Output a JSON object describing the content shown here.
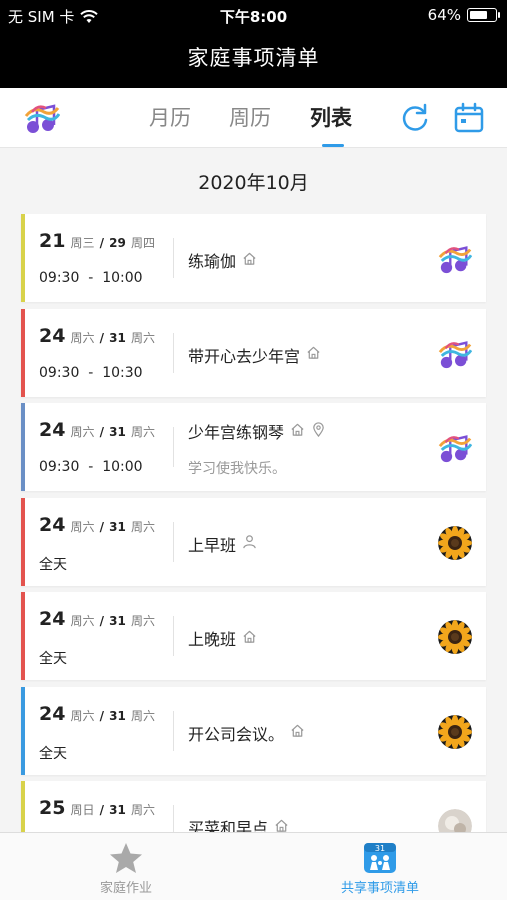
{
  "status": {
    "carrier": "无 SIM 卡",
    "time": "下午8:00",
    "battery": "64%",
    "battery_level": 0.64
  },
  "header": {
    "title": "家庭事项清单"
  },
  "tabs": [
    {
      "label": "月历"
    },
    {
      "label": "周历"
    },
    {
      "label": "列表"
    }
  ],
  "active_tab": "列表",
  "month_heading": "2020年10月",
  "events": [
    {
      "day": "21",
      "weekday": "周三",
      "sep": "/",
      "end_day": "29",
      "end_weekday": "周四",
      "time_start": "09:30",
      "time_dash": "-",
      "time_end": "10:00",
      "time_text": "",
      "title": "练瑜伽",
      "subtitle": "",
      "color": "#d8d24a",
      "icons": [
        "home-icon"
      ],
      "avatar": "app-logo"
    },
    {
      "day": "24",
      "weekday": "周六",
      "sep": "/",
      "end_day": "31",
      "end_weekday": "周六",
      "time_start": "09:30",
      "time_dash": "-",
      "time_end": "10:30",
      "time_text": "",
      "title": "带开心去少年宫",
      "subtitle": "",
      "color": "#e3534e",
      "icons": [
        "home-icon"
      ],
      "avatar": "app-logo"
    },
    {
      "day": "24",
      "weekday": "周六",
      "sep": "/",
      "end_day": "31",
      "end_weekday": "周六",
      "time_start": "09:30",
      "time_dash": "-",
      "time_end": "10:00",
      "time_text": "",
      "title": "少年宫练钢琴",
      "subtitle": "学习使我快乐。",
      "color": "#6a8fc5",
      "icons": [
        "home-icon",
        "location-icon"
      ],
      "avatar": "app-logo"
    },
    {
      "day": "24",
      "weekday": "周六",
      "sep": "/",
      "end_day": "31",
      "end_weekday": "周六",
      "time_start": "",
      "time_dash": "",
      "time_end": "",
      "time_text": "全天",
      "title": "上早班",
      "subtitle": "",
      "color": "#e3534e",
      "icons": [
        "person-icon"
      ],
      "avatar": "sunflower"
    },
    {
      "day": "24",
      "weekday": "周六",
      "sep": "/",
      "end_day": "31",
      "end_weekday": "周六",
      "time_start": "",
      "time_dash": "",
      "time_end": "",
      "time_text": "全天",
      "title": "上晚班",
      "subtitle": "",
      "color": "#e3534e",
      "icons": [
        "home-icon"
      ],
      "avatar": "sunflower"
    },
    {
      "day": "24",
      "weekday": "周六",
      "sep": "/",
      "end_day": "31",
      "end_weekday": "周六",
      "time_start": "",
      "time_dash": "",
      "time_end": "",
      "time_text": "全天",
      "title": "开公司会议。",
      "subtitle": "",
      "color": "#3a9ae0",
      "icons": [
        "home-icon"
      ],
      "avatar": "sunflower"
    },
    {
      "day": "25",
      "weekday": "周日",
      "sep": "/",
      "end_day": "31",
      "end_weekday": "周六",
      "time_start": "",
      "time_dash": "",
      "time_end": "",
      "time_text": "",
      "title": "买菜和早点",
      "subtitle": "",
      "color": "#d8d24a",
      "icons": [
        "home-icon"
      ],
      "avatar": "photo"
    }
  ],
  "bottom_nav": [
    {
      "label": "家庭作业",
      "icon": "star-icon",
      "active": false
    },
    {
      "label": "共享事项清单",
      "icon": "calendar-family-icon",
      "badge": "31",
      "active": true
    }
  ],
  "colors": {
    "accent": "#2f9be8",
    "inactive": "#999999",
    "header_bg": "#000000"
  }
}
